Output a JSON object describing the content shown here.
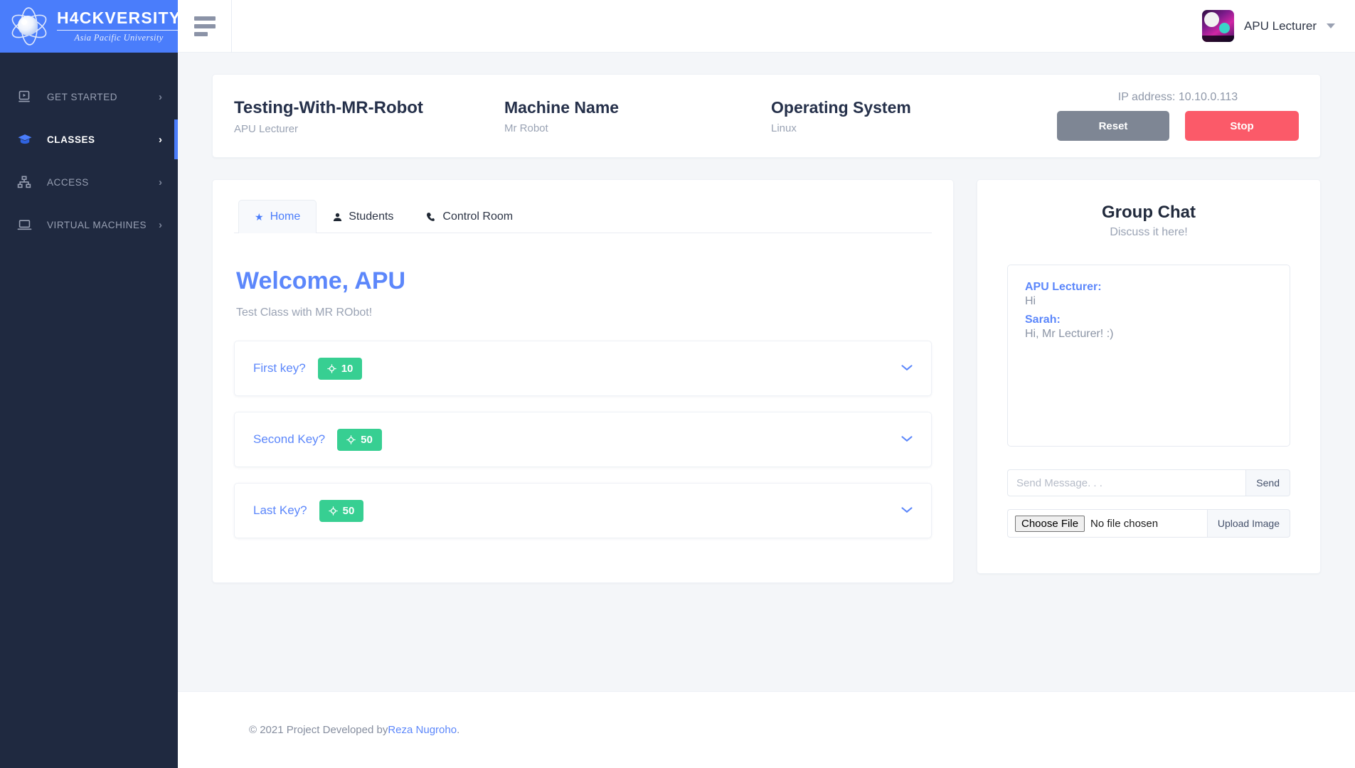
{
  "brand": {
    "title": "H4CKVERSITY",
    "subtitle": "Asia Pacific University",
    "logo_icon": "atom-orbit-icon"
  },
  "sidebar": {
    "items": [
      {
        "label": "GET STARTED",
        "icon": "video-play-monitor-icon",
        "caret": "›",
        "active": false
      },
      {
        "label": "CLASSES",
        "icon": "graduation-cap-icon",
        "caret": "›",
        "active": true
      },
      {
        "label": "ACCESS",
        "icon": "sitemap-icon",
        "caret": "›",
        "active": false
      },
      {
        "label": "VIRTUAL MACHINES",
        "icon": "laptop-icon",
        "caret": "›",
        "active": false
      }
    ]
  },
  "topbar": {
    "menu_toggle_icon": "hamburger-icon",
    "user_name": "APU Lecturer",
    "avatar_icon": "user-avatar-image",
    "dropdown_icon": "caret-down-icon"
  },
  "machine": {
    "class_name": "Testing-With-MR-Robot",
    "class_owner": "APU Lecturer",
    "machine_name_label": "Machine Name",
    "machine_name_value": "Mr Robot",
    "os_label": "Operating System",
    "os_value": "Linux",
    "ip_text": "IP address: 10.10.0.113",
    "reset_label": "Reset",
    "stop_label": "Stop",
    "reset_color": "#7e8694",
    "stop_color": "#fb5a69"
  },
  "tabs": [
    {
      "label": "Home",
      "icon": "star-icon",
      "glyph": "★",
      "active": true
    },
    {
      "label": "Students",
      "icon": "user-icon",
      "glyph": "👤",
      "active": false
    },
    {
      "label": "Control Room",
      "icon": "phone-icon",
      "glyph": "✆",
      "active": false
    }
  ],
  "home": {
    "welcome_title": "Welcome, APU",
    "welcome_subtitle": "Test Class with MR RObot!",
    "accent_color": "#5c87fb",
    "questions": [
      {
        "label": "First key?",
        "points": "10",
        "badge_icon": "crosshair-icon",
        "caret_icon": "chevron-down-icon"
      },
      {
        "label": "Second Key?",
        "points": "50",
        "badge_icon": "crosshair-icon",
        "caret_icon": "chevron-down-icon"
      },
      {
        "label": "Last Key?",
        "points": "50",
        "badge_icon": "crosshair-icon",
        "caret_icon": "chevron-down-icon"
      }
    ],
    "badge_color": "#37cf92"
  },
  "chat": {
    "title": "Group Chat",
    "subtitle": "Discuss it here!",
    "messages": [
      {
        "from": "APU Lecturer:",
        "text": "Hi"
      },
      {
        "from": "Sarah:",
        "text": "Hi, Mr Lecturer! :)"
      }
    ],
    "message_placeholder": "Send Message. . .",
    "message_value": "",
    "send_label": "Send",
    "choose_file_label": "Choose File",
    "file_status": "No file chosen",
    "upload_label": "Upload Image"
  },
  "footer": {
    "text_before": "© 2021 Project Developed by ",
    "link_text": "Reza Nugroho",
    "text_after": "."
  }
}
